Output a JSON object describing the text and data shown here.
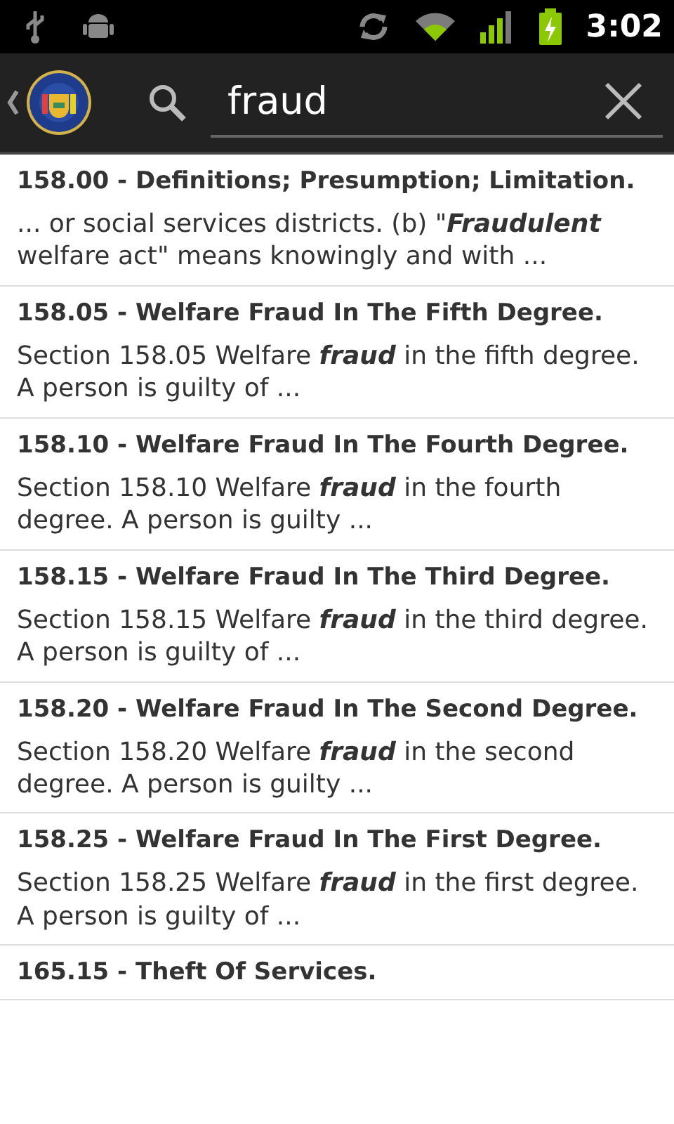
{
  "status_bar": {
    "time": "3:02"
  },
  "action_bar": {
    "search": {
      "value": "fraud"
    }
  },
  "results": [
    {
      "title": "158.00 - Definitions; Presumption; Limitation.",
      "snippet": "... or social services districts. (b) \"**Fraudulent** welfare act\" means knowingly and with ..."
    },
    {
      "title": "158.05 - Welfare Fraud In The Fifth Degree.",
      "snippet": "Section 158.05 Welfare **fraud** in the fifth degree. A person is guilty of ..."
    },
    {
      "title": "158.10 - Welfare Fraud In The Fourth Degree.",
      "snippet": "Section 158.10 Welfare **fraud** in the fourth degree. A person is guilty ..."
    },
    {
      "title": "158.15 - Welfare Fraud In The Third Degree.",
      "snippet": "Section 158.15 Welfare **fraud** in the third degree. A person is guilty of ..."
    },
    {
      "title": "158.20 - Welfare Fraud In The Second Degree.",
      "snippet": "Section 158.20 Welfare **fraud** in the second degree. A person is guilty ..."
    },
    {
      "title": "158.25 - Welfare Fraud In The First Degree.",
      "snippet": "Section 158.25 Welfare **fraud** in the first degree. A person is guilty of ..."
    },
    {
      "title": "165.15 - Theft Of Services."
    }
  ]
}
